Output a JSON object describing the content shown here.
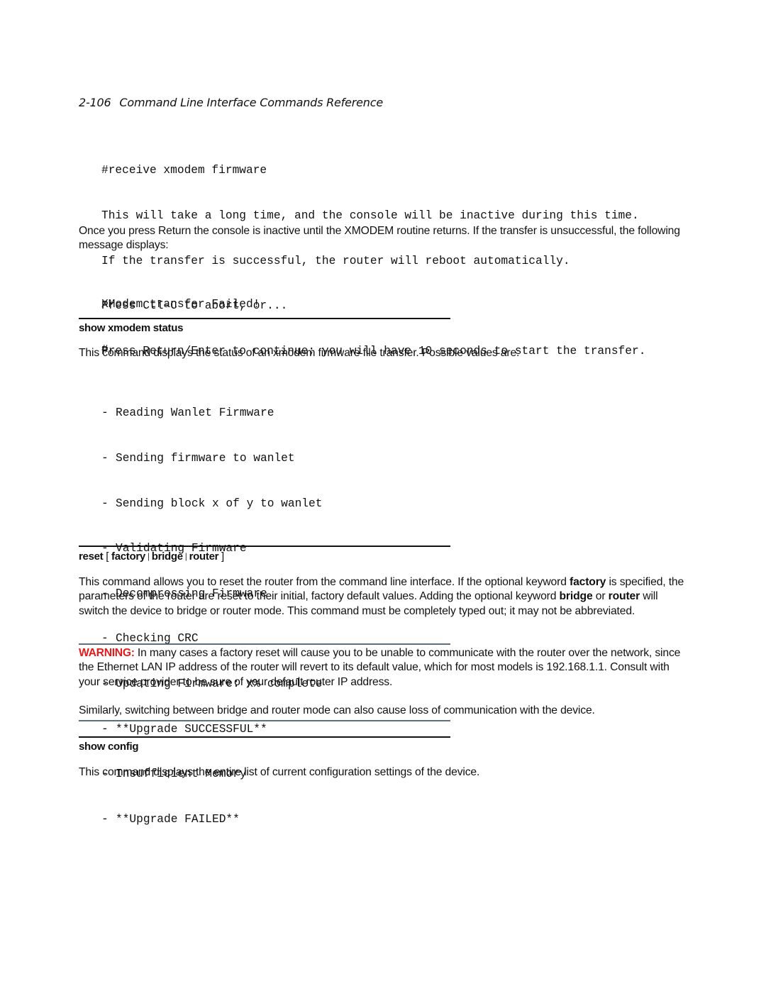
{
  "running_head": {
    "page_number": "2-106",
    "title": "Command Line Interface Commands Reference"
  },
  "receive_xmodem_example": {
    "lines": [
      "#receive xmodem firmware",
      "This will take a long time, and the console will be inactive during this time.",
      "If the transfer is successful, the router will reboot automatically.",
      "Press Ctl-C to abort, or...",
      "Press Return/Enter to continue; you will have 10 seconds to start the transfer."
    ]
  },
  "receive_xmodem_followup": {
    "paragraph": "Once you press Return the console is inactive until the XMODEM routine returns. If the transfer is unsuccessful, the following message displays:",
    "failure_output": [
      "XModem transfer Failed!",
      "#"
    ]
  },
  "show_xmodem_status": {
    "heading": "show xmodem status",
    "description": "This command displays the status of an xmodem firmware file transfer. Possible values are:",
    "bullet": "-",
    "values": [
      "Reading Wanlet Firmware",
      "Sending firmware to wanlet",
      "Sending block x of y to wanlet",
      "Validating Firmware",
      "Decompressing Firmware",
      "Checking CRC",
      "Updating Firmware: x% complete",
      "**Upgrade SUCCESSFUL**",
      "Insufficient Memory",
      "**Upgrade FAILED**"
    ]
  },
  "reset": {
    "heading": {
      "command": "reset",
      "open_bracket": "[",
      "options": [
        "factory",
        "bridge",
        "router"
      ],
      "separator": "|",
      "close_bracket": "]"
    },
    "description": {
      "p1": "This command allows you to reset the router from the command line interface. If the optional keyword ",
      "kw_factory": "factory",
      "p2": " is specified, the parameters of the router are reset to their initial, factory default values. Adding the optional keyword ",
      "kw_bridge": "bridge",
      "p3": " or ",
      "kw_router": "router",
      "p4": " will switch the device to bridge or router mode. This command must be completely typed out; it may not be abbreviated."
    },
    "warning": {
      "label": "WARNING:",
      "text": " In many cases a factory reset will cause you to be unable to communicate with the router over the network, since the Ethernet LAN IP address of the router will revert to its default value, which for most models is 192.168.1.1. Consult with your service provider to be sure of your default router IP address.",
      "note": "Similarly, switching between bridge and router mode can also cause loss of communication with the device.",
      "label_color": "#e41b1b",
      "rule_color": "#5a6f82"
    }
  },
  "show_config": {
    "heading": "show config",
    "description": "This command displays the entire list of current configuration settings of the device."
  }
}
